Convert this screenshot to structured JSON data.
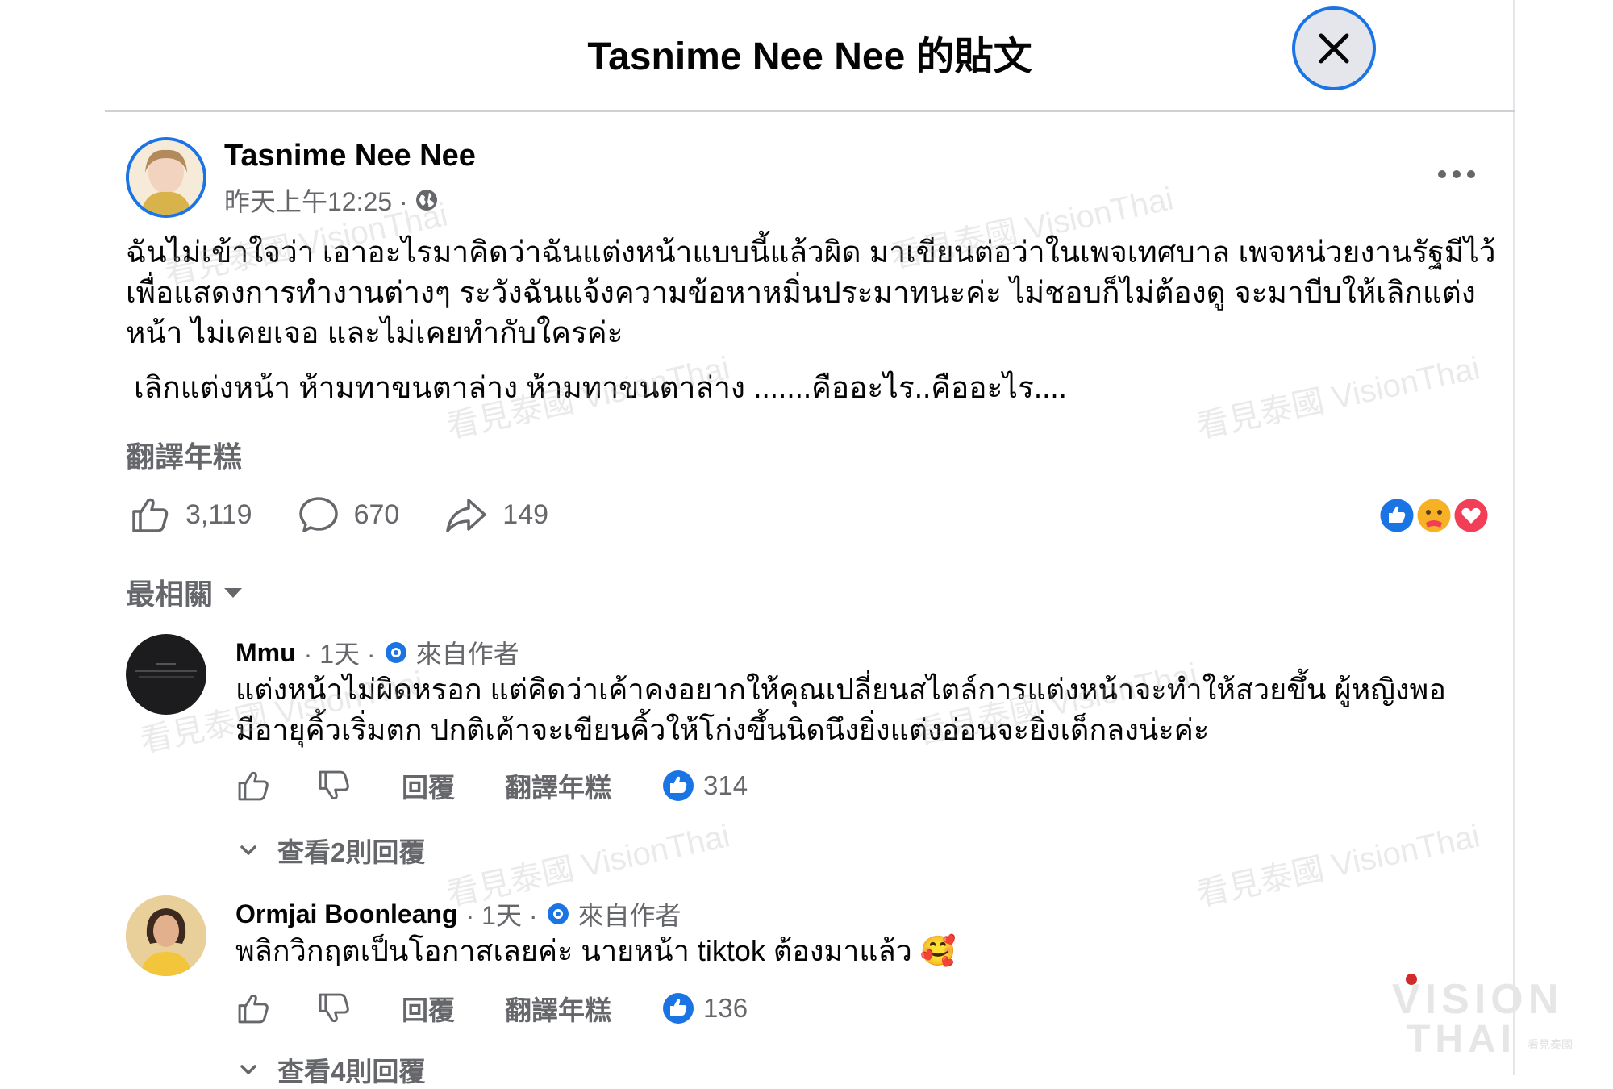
{
  "header": {
    "title": "Tasnime Nee Nee 的貼文"
  },
  "post": {
    "author": "Tasnime Nee Nee",
    "time": "昨天上午12:25 ·",
    "text_line1": "ฉันไม่เข้าใจว่า เอาอะไรมาคิดว่าฉันแต่งหน้าแบบนี้แล้วผิด มาเขียนต่อว่าในเพจเทศบาล เพจหน่วยงานรัฐมีไว้เพื่อแสดงการทำงานต่างๆ ระวังฉันแจ้งความข้อหาหมิ่นประมาทนะค่ะ ไม่ชอบก็ไม่ต้องดู จะมาบีบให้เลิกแต่งหน้า ไม่เคยเจอ และไม่เคยทำกับใครค่ะ",
    "text_line2": "เลิกแต่งหน้า ห้ามทาขนตาล่าง ห้ามทาขนตาล่าง .......คืออะไร..คืออะไร....",
    "translate": "翻譯年糕",
    "likes": "3,119",
    "comments": "670",
    "shares": "149"
  },
  "sort": {
    "label": "最相關"
  },
  "comments": [
    {
      "name": "Mmu",
      "time": "· 1天 ·",
      "badge": "來自作者",
      "text": "แต่งหน้าไม่ผิดหรอก แต่คิดว่าเค้าคงอยากให้คุณเปลี่ยนสไตล์การแต่งหน้าจะทำให้สวยขึ้น ผู้หญิงพอมีอายุคิ้วเริ่มตก ปกติเค้าจะเขียนคิ้วให้โก่งขึ้นนิดนึงยิ่งแต่งอ่อนจะยิ่งเด็กลงน่ะค่ะ",
      "reply": "回覆",
      "translate": "翻譯年糕",
      "likes": "314",
      "view_replies": "查看2則回覆"
    },
    {
      "name": "Ormjai Boonleang",
      "time": "· 1天 ·",
      "badge": "來自作者",
      "text": "พลิกวิกฤตเป็นโอกาสเลยค่ะ นายหน้า tiktok ต้องมาแล้ว 🥰",
      "reply": "回覆",
      "translate": "翻譯年糕",
      "likes": "136",
      "view_replies": "查看4則回覆"
    }
  ],
  "watermark_text": "看見泰國 VisionThai",
  "logo": {
    "line1": "VISION",
    "line2": "THAI",
    "sub": "看見泰國"
  },
  "colors": {
    "accent": "#1b74e4",
    "secondary_text": "#65676b",
    "love": "#f33e58"
  }
}
